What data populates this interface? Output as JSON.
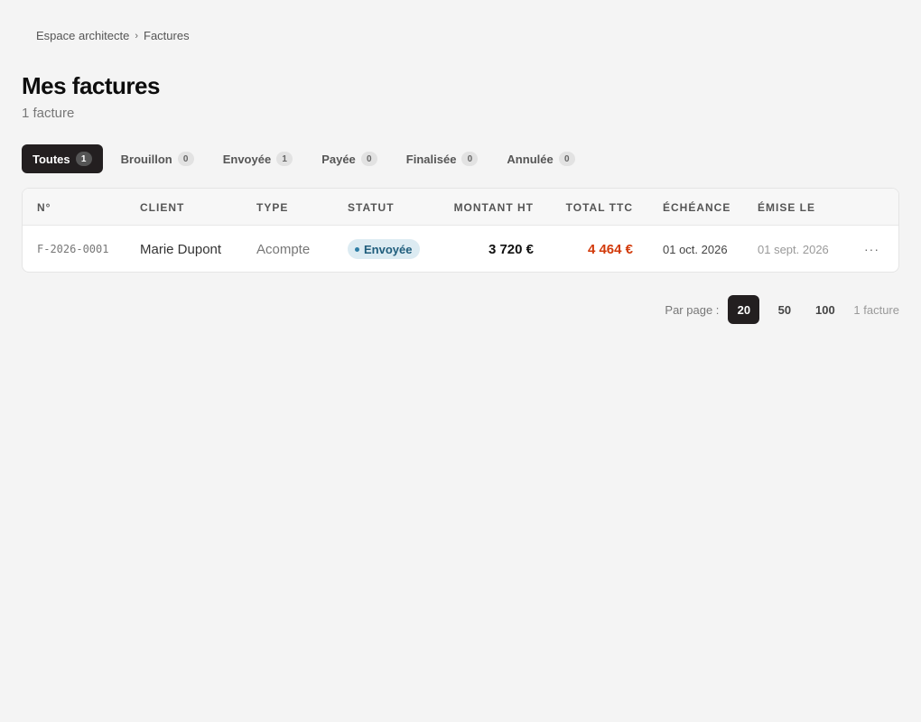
{
  "breadcrumb": {
    "items": [
      "Espace architecte",
      "Factures"
    ],
    "separator": "›"
  },
  "page": {
    "title": "Mes factures",
    "subtitle": "1 facture"
  },
  "tabs": [
    {
      "label": "Toutes",
      "count": "1",
      "active": true
    },
    {
      "label": "Brouillon",
      "count": "0"
    },
    {
      "label": "Envoyée",
      "count": "1"
    },
    {
      "label": "Payée",
      "count": "0"
    },
    {
      "label": "Finalisée",
      "count": "0"
    },
    {
      "label": "Annulée",
      "count": "0"
    }
  ],
  "table": {
    "headers": {
      "number": "N°",
      "client": "CLIENT",
      "type": "TYPE",
      "status": "STATUT",
      "amount_ht": "MONTANT HT",
      "total_ttc": "TOTAL TTC",
      "due": "ÉCHÉANCE",
      "issued": "ÉMISE LE"
    },
    "rows": [
      {
        "number": "F-2026-0001",
        "client": "Marie Dupont",
        "type": "Acompte",
        "status": "Envoyée",
        "amount_ht": "3 720 €",
        "total_ttc": "4 464 €",
        "due": "01 oct. 2026",
        "issued": "01 sept. 2026",
        "more": "···"
      }
    ]
  },
  "pagination": {
    "label": "Par page :",
    "options": [
      "20",
      "50",
      "100"
    ],
    "selected": "20",
    "total": "1 facture"
  },
  "colors": {
    "accent_dark": "#231f20",
    "status_sent_bg": "#dcebf2",
    "status_sent_text": "#1f5d7c",
    "ttc_total": "#d23a0a"
  }
}
